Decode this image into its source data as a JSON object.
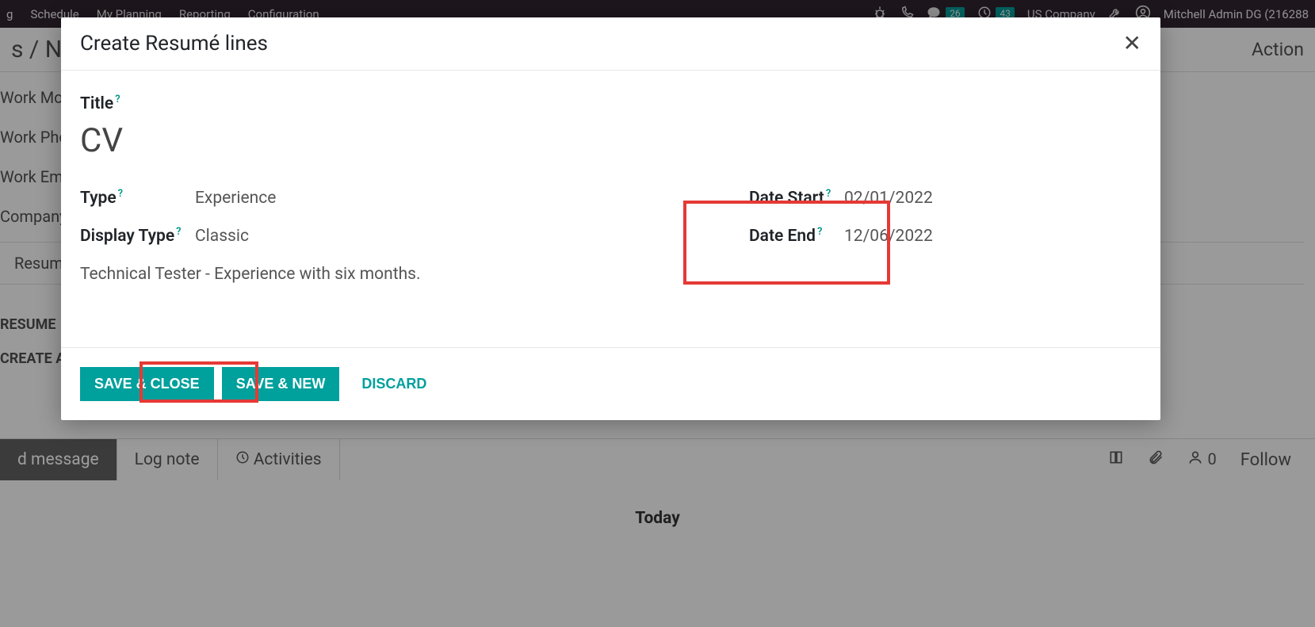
{
  "topbar": {
    "menus": [
      "g",
      "Schedule",
      "My Planning",
      "Reporting",
      "Configuration"
    ],
    "messages_count": "26",
    "activities_count": "43",
    "company": "US Company",
    "user": "Mitchell Admin DG (216288"
  },
  "breadcrumb": {
    "text": "s / New",
    "action": "Action"
  },
  "bg_form": {
    "rows": [
      "Work Mo",
      "Work Pho",
      "Work Ema",
      "Company"
    ],
    "tab": "Resumé",
    "section": "RESUME",
    "create": "CREATE A"
  },
  "chatter": {
    "send": "d message",
    "log": "Log note",
    "activities": "Activities",
    "follow_count": "0",
    "follow": "Follow"
  },
  "today_label": "Today",
  "modal": {
    "title": "Create Resumé lines",
    "fields": {
      "title_label": "Title",
      "title_value": "CV",
      "type_label": "Type",
      "type_value": "Experience",
      "display_type_label": "Display Type",
      "display_type_value": "Classic",
      "description": "Technical Tester - Experience with six months.",
      "date_start_label": "Date Start",
      "date_start_value": "02/01/2022",
      "date_end_label": "Date End",
      "date_end_value": "12/06/2022",
      "help_marker": "?"
    },
    "buttons": {
      "save_close": "SAVE & CLOSE",
      "save_new": "SAVE & NEW",
      "discard": "DISCARD"
    }
  }
}
